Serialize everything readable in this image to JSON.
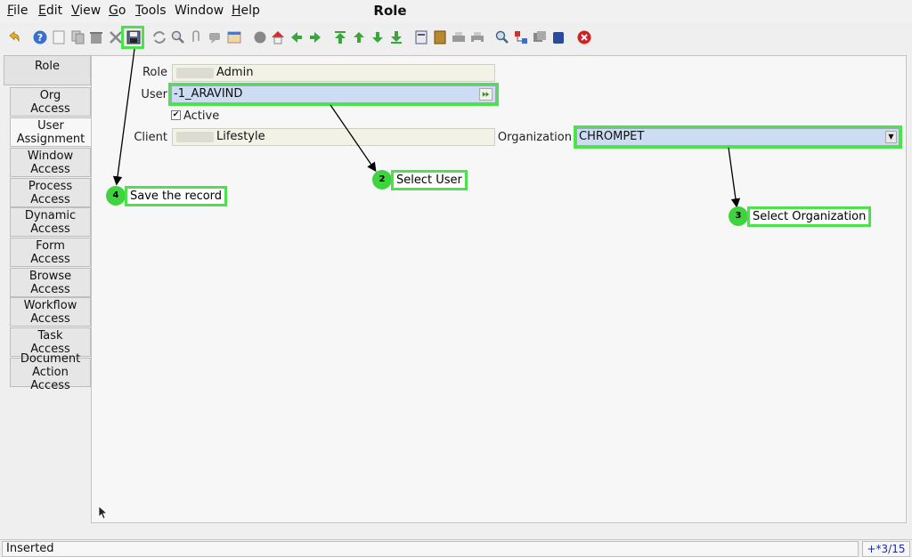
{
  "window": {
    "title": "Role"
  },
  "menu": [
    {
      "mn": "F",
      "rest": "ile"
    },
    {
      "mn": "E",
      "rest": "dit"
    },
    {
      "mn": "V",
      "rest": "iew"
    },
    {
      "mn": "G",
      "rest": "o"
    },
    {
      "mn": "T",
      "rest": "ools"
    },
    {
      "mn": "",
      "rest": "Window"
    },
    {
      "mn": "H",
      "rest": "elp"
    }
  ],
  "toolbar": {
    "icons": [
      "undo-icon",
      "help-icon",
      "new-icon",
      "copy-icon",
      "delete-icon",
      "delete-selection-icon",
      "save-icon",
      "refresh-icon",
      "find-icon",
      "attachment-icon",
      "chat-icon",
      "history-icon",
      "home-icon",
      "parent-icon",
      "previous-icon",
      "next-icon",
      "first-record-icon",
      "previous-record-icon",
      "next-record-icon",
      "last-record-icon",
      "report-icon",
      "archive-icon",
      "print-preview-icon",
      "print-icon",
      "zoom-across-icon",
      "workflow-icon",
      "active-workflows-icon",
      "requests-icon",
      "close-window-icon"
    ]
  },
  "tabs": {
    "role": "Role",
    "items": [
      {
        "l1": "Org",
        "l2": "Access"
      },
      {
        "l1": "User",
        "l2": "Assignment"
      },
      {
        "l1": "Window",
        "l2": "Access"
      },
      {
        "l1": "Process",
        "l2": "Access"
      },
      {
        "l1": "Dynamic",
        "l2": "Access"
      },
      {
        "l1": "Form",
        "l2": "Access"
      },
      {
        "l1": "Browse",
        "l2": "Access"
      },
      {
        "l1": "Workflow",
        "l2": "Access"
      },
      {
        "l1": "Task",
        "l2": "Access"
      },
      {
        "l1": "Document",
        "l2": "Action Access"
      }
    ]
  },
  "form": {
    "role_label": "Role",
    "role_value": "Admin",
    "user_label": "User",
    "user_value": "-1_ARAVIND",
    "active_label": "Active",
    "client_label": "Client",
    "client_value": "Lifestyle",
    "org_label": "Organization",
    "org_value": "CHROMPET"
  },
  "annotations": {
    "save": {
      "num": "4",
      "text": "Save the record"
    },
    "user": {
      "num": "2",
      "text": "Select User"
    },
    "org": {
      "num": "3",
      "text": "Select Organization"
    }
  },
  "status": {
    "text": "Inserted",
    "record": "+*3/15"
  }
}
